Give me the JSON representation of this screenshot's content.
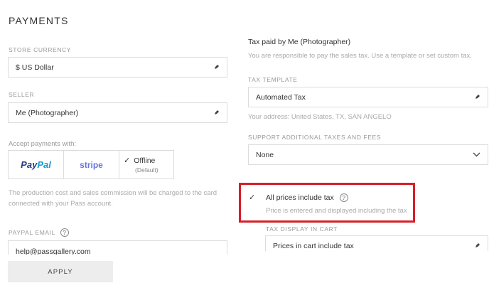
{
  "section_title": "PAYMENTS",
  "store_currency": {
    "label": "STORE CURRENCY",
    "value": "$ US Dollar"
  },
  "seller": {
    "label": "SELLER",
    "value": "Me (Photographer)"
  },
  "payments": {
    "label": "Accept payments with:",
    "paypal_part1": "Pay",
    "paypal_part2": "Pal",
    "stripe": "stripe",
    "offline_label": "Offline",
    "offline_sub": "(Default)"
  },
  "commission_note": "The production cost and sales commission will be charged to the card connected with your Pass account.",
  "paypal_email": {
    "label": "PAYPAL EMAIL",
    "value": "help@passgallery.com"
  },
  "tax": {
    "title": "Tax paid by Me (Photographer)",
    "desc": "You are responsible to pay the sales tax. Use a template or set custom tax.",
    "template_label": "TAX TEMPLATE",
    "template_value": "Automated Tax",
    "address": "Your address: United States, TX, SAN ANGELO",
    "additional_label": "SUPPORT ADDITIONAL TAXES AND FEES",
    "additional_value": "None",
    "include_label": "All prices include tax",
    "include_desc": "Price is entered and displayed including the tax",
    "display_label": "TAX DISPLAY IN CART",
    "display_value": "Prices in cart include tax"
  },
  "apply_label": "APPLY",
  "colors": {
    "highlight": "#d81e27",
    "paypal_dark": "#253b80",
    "paypal_light": "#179bd7",
    "stripe": "#6772e5"
  },
  "icons": [
    "pencil-icon",
    "check-icon",
    "question-icon",
    "chevron-down-icon"
  ]
}
